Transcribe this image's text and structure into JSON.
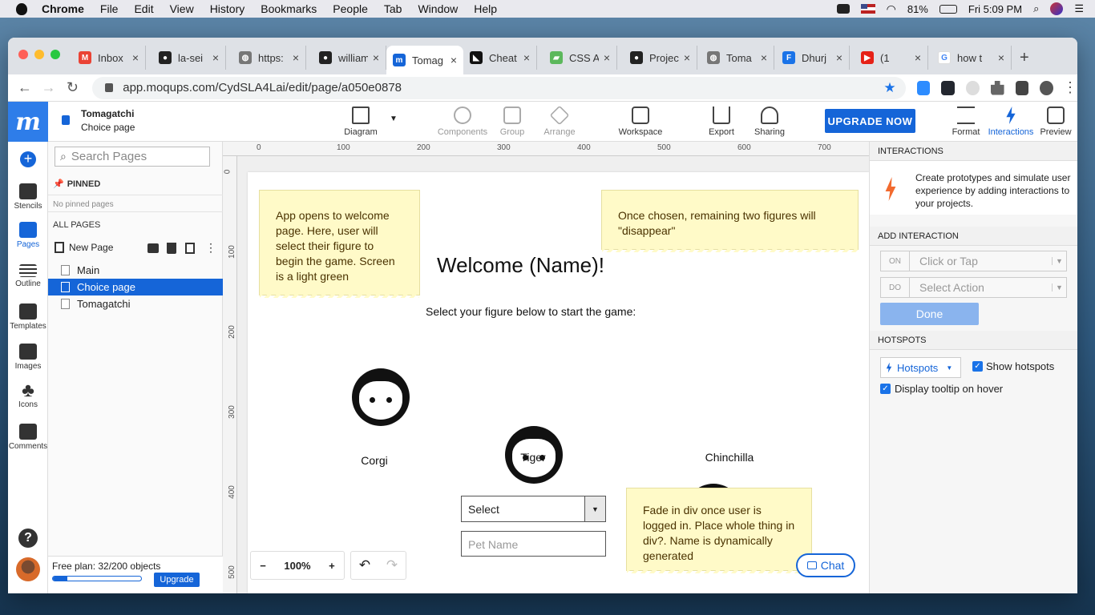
{
  "menubar": {
    "app": "Chrome",
    "items": [
      "File",
      "Edit",
      "View",
      "History",
      "Bookmarks",
      "People",
      "Tab",
      "Window",
      "Help"
    ],
    "battery": "81%",
    "clock": "Fri 5:09 PM"
  },
  "tabs": [
    {
      "title": "Inbox",
      "color": "#ea4335",
      "glyph": "M"
    },
    {
      "title": "la-sei",
      "color": "#222",
      "glyph": "●"
    },
    {
      "title": "https:",
      "color": "#777",
      "glyph": "◍"
    },
    {
      "title": "william",
      "color": "#222",
      "glyph": "●"
    },
    {
      "title": "Tomag",
      "color": "#1565d8",
      "glyph": "m"
    },
    {
      "title": "Cheat",
      "color": "#111",
      "glyph": "◣"
    },
    {
      "title": "CSS A",
      "color": "#5cb85c",
      "glyph": "▰"
    },
    {
      "title": "Projec",
      "color": "#222",
      "glyph": "●"
    },
    {
      "title": "Toma",
      "color": "#777",
      "glyph": "◍"
    },
    {
      "title": "Dhurj",
      "color": "#1a73e8",
      "glyph": "F"
    },
    {
      "title": "(1",
      "color": "#e62117",
      "glyph": "▶"
    },
    {
      "title": "how t",
      "color": "#fff",
      "glyph": "G"
    }
  ],
  "url": "app.moqups.com/CydSLA4Lai/edit/page/a050e0878",
  "app": {
    "project": "Tomagatchi",
    "page": "Choice page",
    "toolbar": {
      "diagram": "Diagram",
      "components": "Components",
      "group": "Group",
      "arrange": "Arrange",
      "workspace": "Workspace",
      "export": "Export",
      "sharing": "Sharing",
      "upgrade": "UPGRADE NOW",
      "format": "Format",
      "interactions": "Interactions",
      "preview": "Preview"
    },
    "rail": {
      "stencils": "Stencils",
      "pages": "Pages",
      "outline": "Outline",
      "templates": "Templates",
      "images": "Images",
      "icons": "Icons",
      "comments": "Comments"
    },
    "pages_panel": {
      "search_placeholder": "Search Pages",
      "pinned_header": "PINNED",
      "no_pinned": "No pinned pages",
      "all_pages": "ALL PAGES",
      "new_page": "New Page",
      "pages": [
        "Main",
        "Choice page",
        "Tomagatchi"
      ],
      "selected": "Choice page",
      "plan": "Free plan: 32/200 objects",
      "plan_usage": 0.16,
      "upgrade": "Upgrade"
    },
    "ruler": {
      "h": [
        "0",
        "100",
        "200",
        "300",
        "400",
        "500",
        "600",
        "700"
      ],
      "v": [
        "0",
        "100",
        "200",
        "300",
        "400",
        "500"
      ]
    },
    "canvas": {
      "note1": "App opens to welcome page. Here, user will select their figure to begin the game. Screen is a light green",
      "note2": "Once chosen, remaining two figures will \"disappear\"",
      "note3": "Fade in div once user is logged in. Place whole thing in div?. Name is dynamically generated",
      "title": "Welcome (Name)!",
      "subtitle": "Select your figure below to start the game:",
      "figures": [
        "Corgi",
        "Tiger",
        "Chinchilla"
      ],
      "select": "Select",
      "pet_placeholder": "Pet Name",
      "zoom": "100%",
      "chat": "Chat"
    },
    "right_panel": {
      "interactions_header": "INTERACTIONS",
      "interactions_desc": "Create prototypes and simulate user experience by adding interactions to your projects.",
      "add_header": "ADD INTERACTION",
      "on_tag": "ON",
      "on_value": "Click or Tap",
      "do_tag": "DO",
      "do_value": "Select Action",
      "done": "Done",
      "hotspots_header": "HOTSPOTS",
      "hotspots_btn": "Hotspots",
      "show_hotspots": "Show hotspots",
      "tooltip": "Display tooltip on hover"
    }
  }
}
